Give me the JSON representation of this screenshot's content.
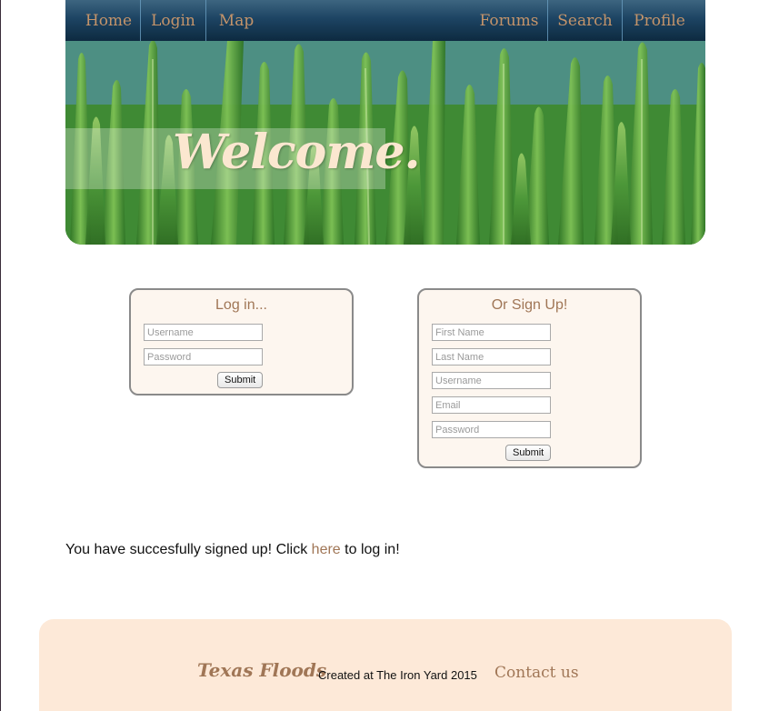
{
  "nav": {
    "left_items": [
      "Home",
      "Login",
      "Map"
    ],
    "right_items": [
      "Forums",
      "Search",
      "Profile"
    ],
    "colors": {
      "text": "#c4946a",
      "bar": "#1d4463"
    }
  },
  "hero": {
    "heading": "Welcome."
  },
  "login": {
    "title": "Log in...",
    "username_placeholder": "Username",
    "password_placeholder": "Password",
    "submit_label": "Submit"
  },
  "signup": {
    "title": "Or Sign Up!",
    "first_name_placeholder": "First Name",
    "last_name_placeholder": "Last Name",
    "username_placeholder": "Username",
    "email_placeholder": "Email",
    "password_placeholder": "Password",
    "submit_label": "Submit"
  },
  "message": {
    "prefix": "You have succesfully signed up! Click ",
    "link_text": "here",
    "suffix": " to log in!"
  },
  "footer": {
    "brand": "Texas Floods",
    "credit": "Created at The Iron Yard 2015",
    "contact": "Contact us",
    "background": "#fde9d8",
    "accent": "#a07656"
  }
}
